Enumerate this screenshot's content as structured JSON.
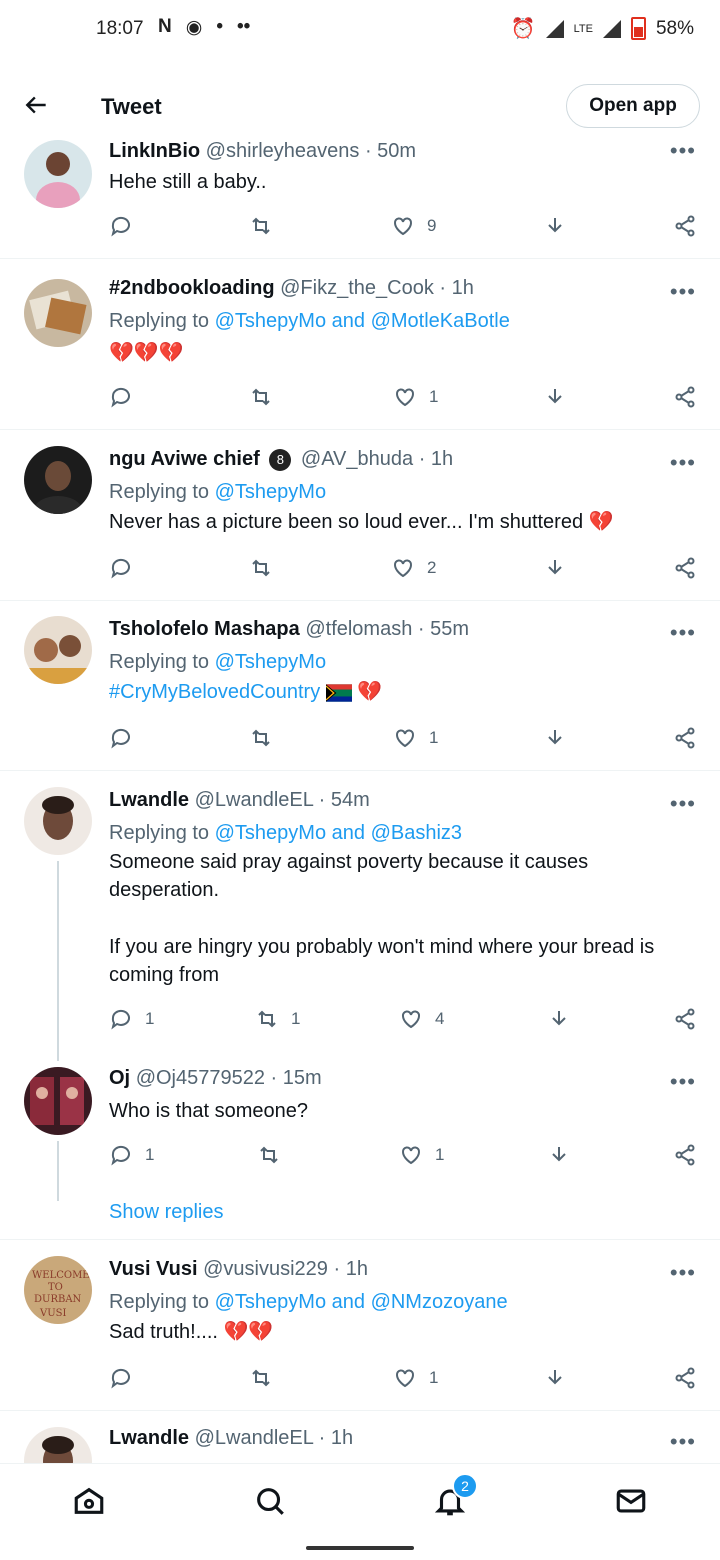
{
  "status_bar": {
    "time": "18:07",
    "battery": "58%",
    "lte": "LTE"
  },
  "header": {
    "back_icon": "arrow-left-icon",
    "title": "Tweet",
    "open_app": "Open app"
  },
  "tweets": [
    {
      "name": "LinkInBio",
      "handle": "@shirleyheavens",
      "time": "50m",
      "text": "Hehe still a baby..",
      "replies": "",
      "retweets": "",
      "likes": "9"
    },
    {
      "name": "#2ndbookloading",
      "handle": "@Fikz_the_Cook",
      "time": "1h",
      "replying_label": "Replying to",
      "replying_to": "@TshepyMo and @MotleKaBotle",
      "text": "💔💔💔",
      "likes": "1"
    },
    {
      "name": "ngu Aviwe chief",
      "badge": "8",
      "handle": "@AV_bhuda",
      "time": "1h",
      "replying_label": "Replying to",
      "replying_to": "@TshepyMo",
      "text": "Never has a picture been so loud ever... I'm shuttered 💔",
      "likes": "2"
    },
    {
      "name": "Tsholofelo Mashapa",
      "handle": "@tfelomash",
      "time": "55m",
      "replying_label": "Replying to",
      "replying_to": "@TshepyMo",
      "text": "#CryMyBelovedCountry",
      "text_suffix": "💔",
      "likes": "1"
    },
    {
      "name": "Lwandle",
      "handle": "@LwandleEL",
      "time": "54m",
      "replying_label": "Replying to",
      "replying_to": "@TshepyMo and @Bashiz3",
      "text_1": "Someone said pray against poverty because it causes",
      "text_2": "desperation.",
      "text_3": "If you are hingry you probably won't mind where your bread is",
      "text_4": "coming from",
      "replies": "1",
      "retweets": "1",
      "likes": "4"
    },
    {
      "name": "Oj",
      "handle": "@Oj45779522",
      "time": "15m",
      "text": "Who is that someone?",
      "replies": "1",
      "likes": "1"
    },
    {
      "show_replies": "Show replies"
    },
    {
      "name": "Vusi Vusi",
      "handle": "@vusivusi229",
      "time": "1h",
      "replying_label": "Replying to",
      "replying_to": "@TshepyMo and @NMzozoyane",
      "text": "Sad truth!.... 💔💔",
      "likes": "1"
    },
    {
      "name": "Lwandle",
      "handle": "@LwandleEL",
      "time": "1h"
    }
  ],
  "avatar_5_text": [
    "WELCOME",
    "TO",
    "DURBAN",
    "VUSI"
  ],
  "bottom_nav": {
    "notifications_badge": "2"
  },
  "colors": {
    "accent": "#1d9bf0",
    "text": "#0f1419",
    "muted": "#536471",
    "heart": "#d0243b"
  }
}
